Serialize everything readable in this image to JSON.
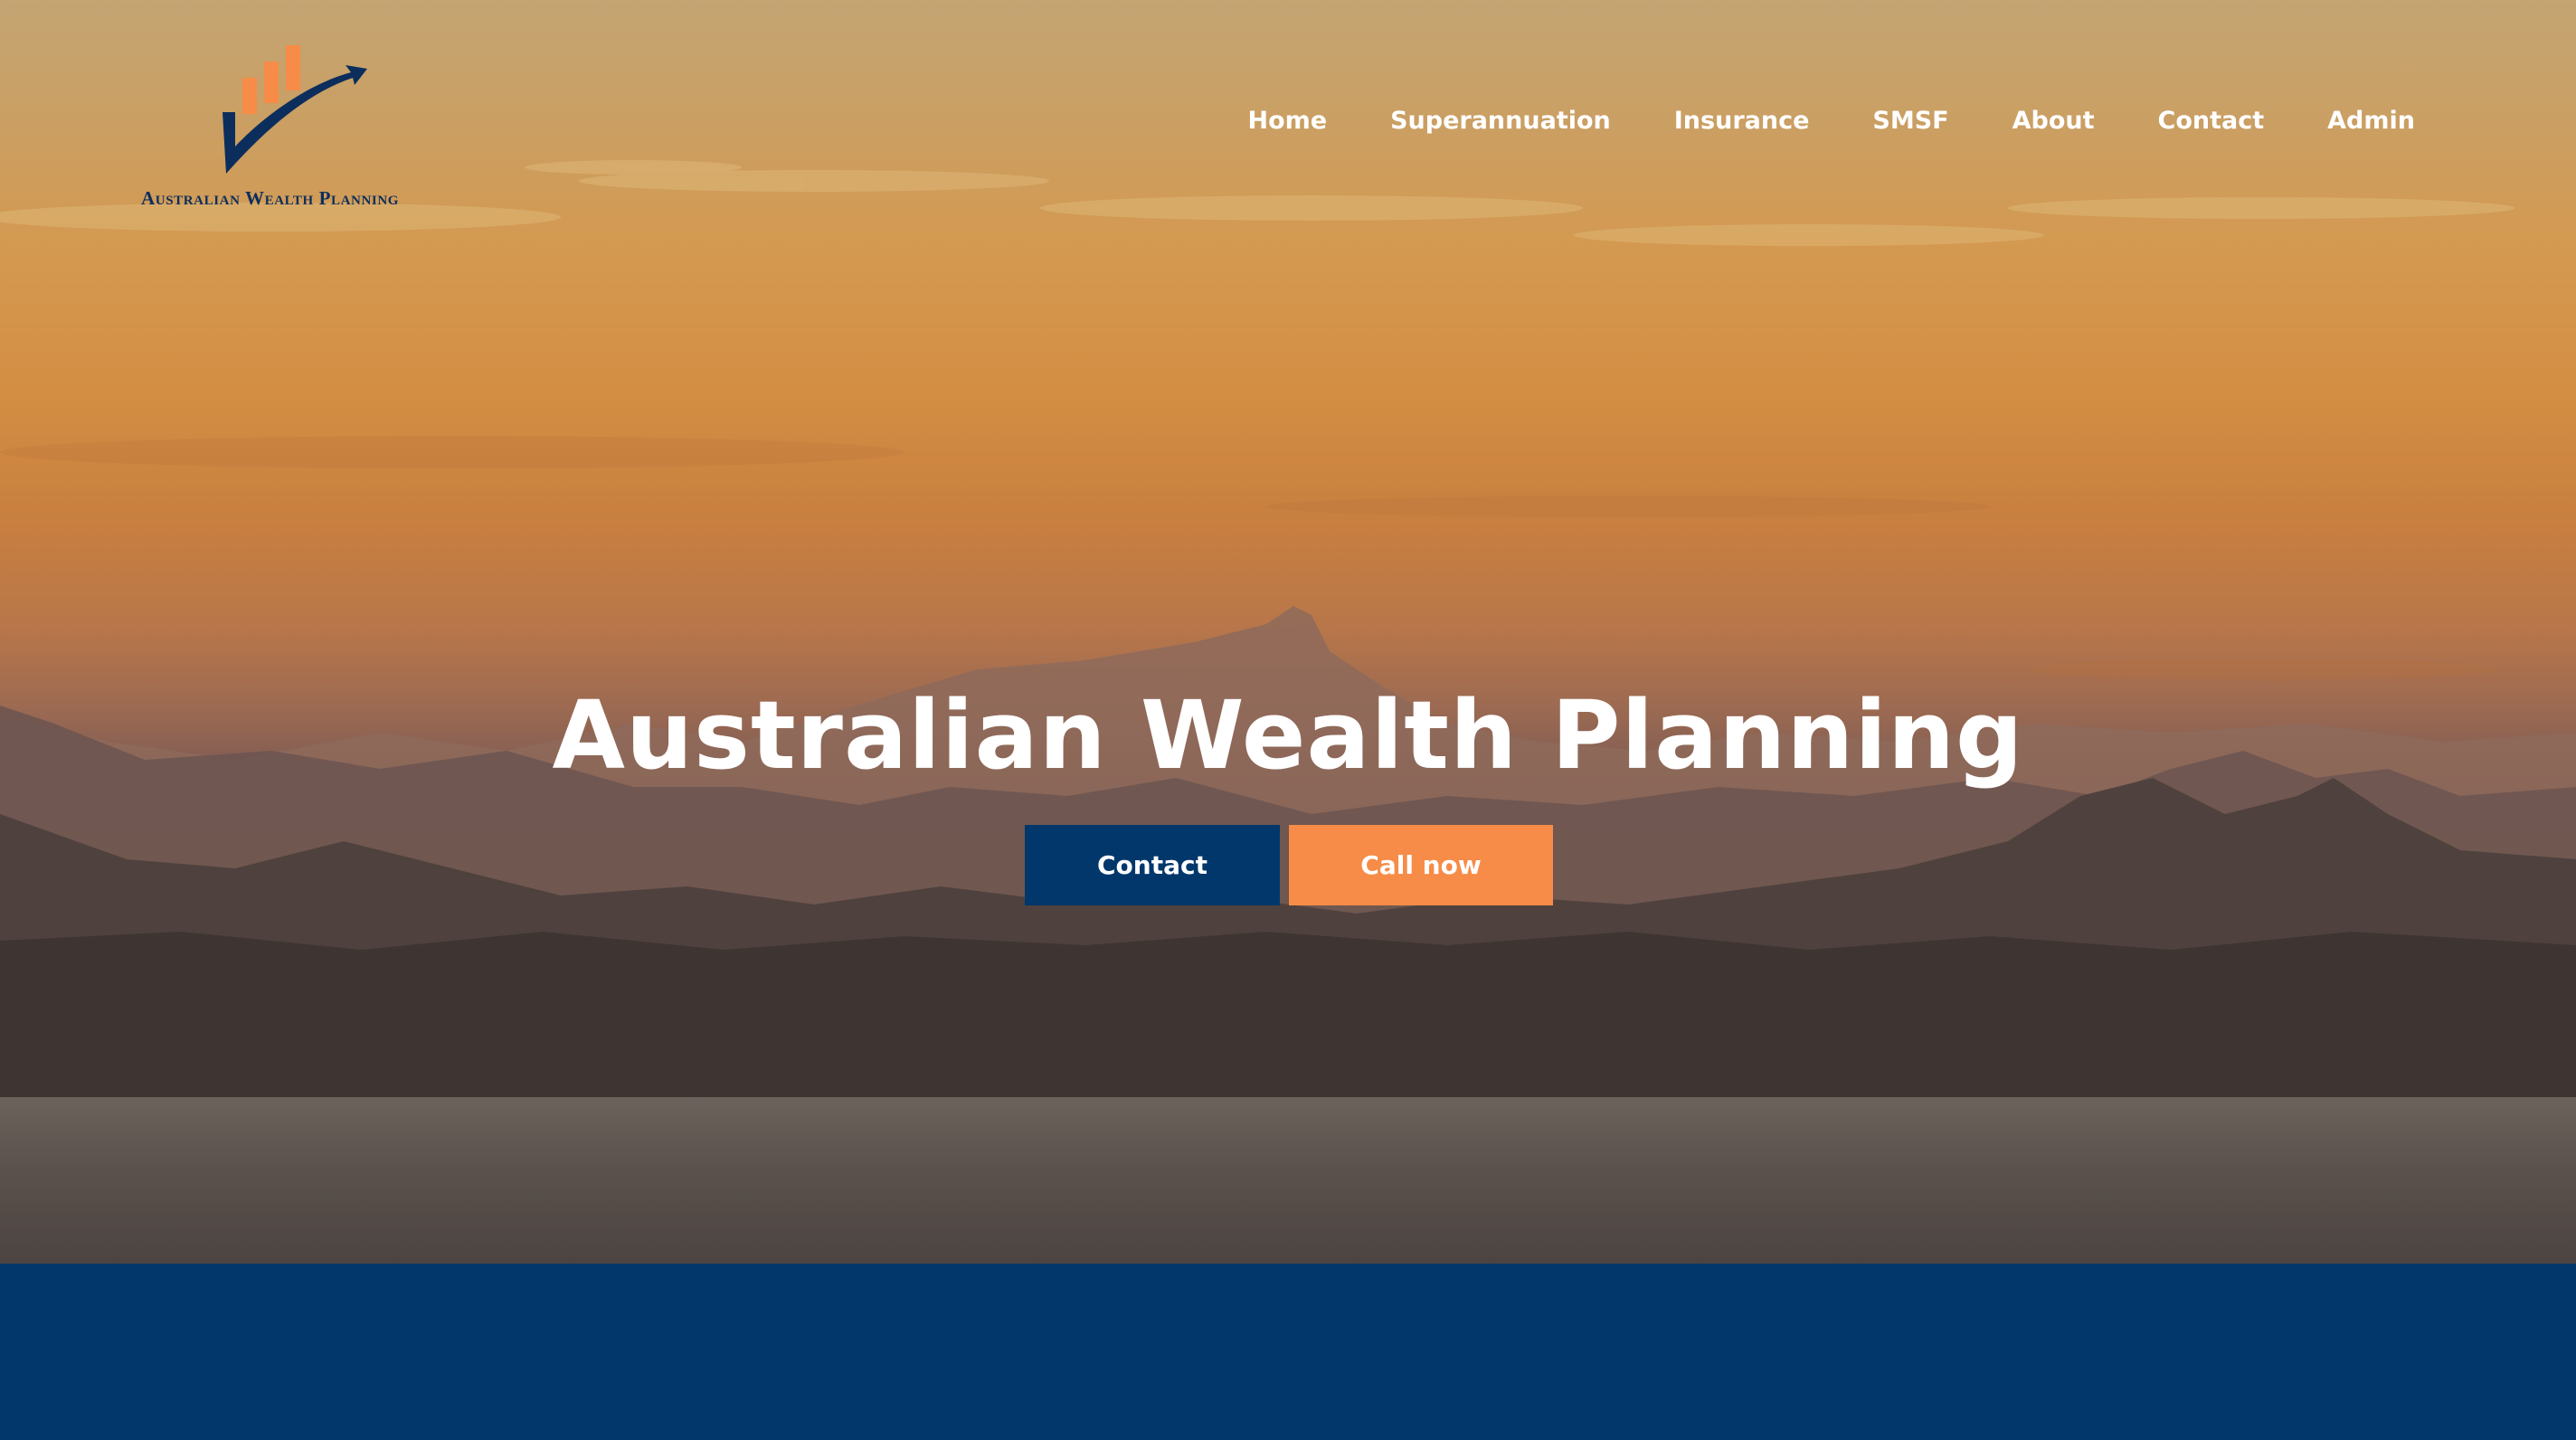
{
  "brand": {
    "name": "Australian Wealth Planning",
    "logo_icon": "checkmark-bar-chart-logo",
    "colors": {
      "navy": "#02376b",
      "orange": "#f68c48",
      "logo_navy": "#0c2e5c"
    }
  },
  "nav": {
    "items": [
      {
        "label": "Home"
      },
      {
        "label": "Superannuation"
      },
      {
        "label": "Insurance"
      },
      {
        "label": "SMSF"
      },
      {
        "label": "About"
      },
      {
        "label": "Contact"
      },
      {
        "label": "Admin"
      }
    ]
  },
  "hero": {
    "title": "Australian Wealth Planning",
    "buttons": {
      "contact_label": "Contact",
      "call_label": "Call now"
    }
  }
}
